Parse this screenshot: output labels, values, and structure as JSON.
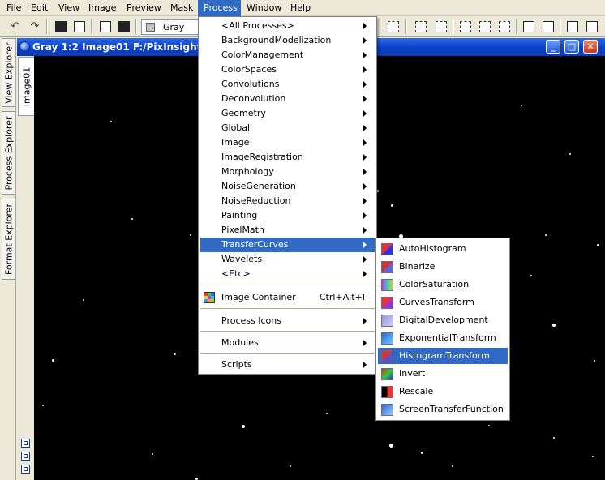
{
  "menubar": {
    "items": [
      {
        "label": "File"
      },
      {
        "label": "Edit"
      },
      {
        "label": "View"
      },
      {
        "label": "Image"
      },
      {
        "label": "Preview"
      },
      {
        "label": "Mask"
      },
      {
        "label": "Process",
        "active": true
      },
      {
        "label": "Window"
      },
      {
        "label": "Help"
      }
    ]
  },
  "toolbar": {
    "colorspace": "Gray"
  },
  "left_tabs": [
    "View Explorer",
    "Process Explorer",
    "Format Explorer"
  ],
  "image_window": {
    "title": "Gray 1:2 Image01 F:/PixInsight A",
    "tab_label": "Image01",
    "buttons": {
      "minimize": "_",
      "maximize": "□",
      "close": "✕"
    }
  },
  "process_menu": {
    "items": [
      {
        "label": "<All Processes>",
        "submenu": true
      },
      {
        "label": "BackgroundModelization",
        "submenu": true
      },
      {
        "label": "ColorManagement",
        "submenu": true
      },
      {
        "label": "ColorSpaces",
        "submenu": true
      },
      {
        "label": "Convolutions",
        "submenu": true
      },
      {
        "label": "Deconvolution",
        "submenu": true
      },
      {
        "label": "Geometry",
        "submenu": true
      },
      {
        "label": "Global",
        "submenu": true
      },
      {
        "label": "Image",
        "submenu": true
      },
      {
        "label": "ImageRegistration",
        "submenu": true
      },
      {
        "label": "Morphology",
        "submenu": true
      },
      {
        "label": "NoiseGeneration",
        "submenu": true
      },
      {
        "label": "NoiseReduction",
        "submenu": true
      },
      {
        "label": "Painting",
        "submenu": true
      },
      {
        "label": "PixelMath",
        "submenu": true
      },
      {
        "label": "TransferCurves",
        "submenu": true,
        "highlighted": true
      },
      {
        "label": "Wavelets",
        "submenu": true
      },
      {
        "label": "<Etc>",
        "submenu": true
      }
    ],
    "image_container": {
      "label": "Image Container",
      "shortcut": "Ctrl+Alt+I"
    },
    "process_icons": "Process Icons",
    "modules": "Modules",
    "scripts": "Scripts"
  },
  "transfer_curves_submenu": {
    "items": [
      {
        "label": "AutoHistogram",
        "icon": "autohistogram-icon"
      },
      {
        "label": "Binarize",
        "icon": "binarize-icon"
      },
      {
        "label": "ColorSaturation",
        "icon": "colorsaturation-icon"
      },
      {
        "label": "CurvesTransform",
        "icon": "curves-icon"
      },
      {
        "label": "DigitalDevelopment",
        "icon": "digitaldevelopment-icon"
      },
      {
        "label": "ExponentialTransform",
        "icon": "exponential-icon"
      },
      {
        "label": "HistogramTransform",
        "icon": "histogram-icon",
        "highlighted": true
      },
      {
        "label": "Invert",
        "icon": "invert-icon"
      },
      {
        "label": "Rescale",
        "icon": "rescale-icon"
      },
      {
        "label": "ScreenTransferFunction",
        "icon": "stf-icon"
      }
    ]
  },
  "colors": {
    "highlight": "#316ac5",
    "menu_bg": "#ffffff",
    "chrome": "#ece9d8",
    "canvas": "#000000"
  }
}
